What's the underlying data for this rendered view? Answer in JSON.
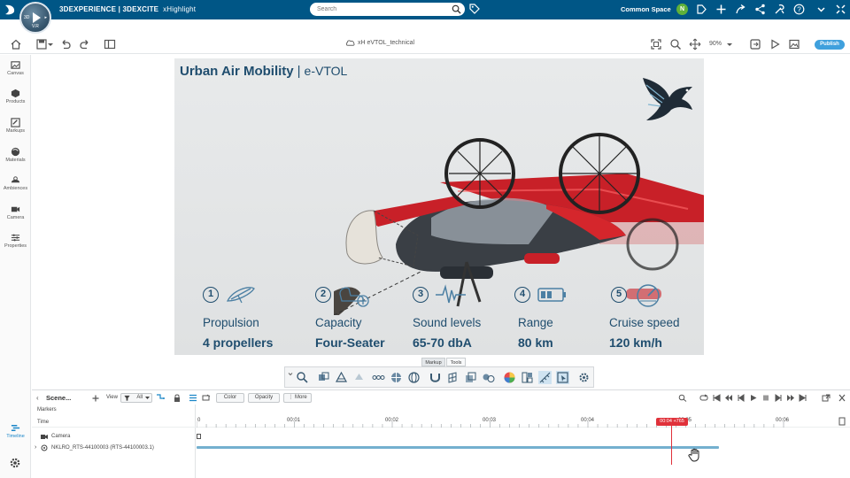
{
  "header": {
    "brand_bold": "3DEXPERIENCE | 3DEXCITE",
    "brand_app": "xHighlight",
    "compass_version": "V.R",
    "compass_left": "3D",
    "compass_right": "▸",
    "search_placeholder": "Search",
    "space_label": "Common Space",
    "avatar_initial": "N"
  },
  "toolbar": {
    "document_title": "xH eVTOL_technical",
    "zoom_level": "90%",
    "publish_label": "Publish"
  },
  "sidebar": {
    "items": [
      {
        "label": "Canvas",
        "icon": "canvas-icon"
      },
      {
        "label": "Products",
        "icon": "products-icon"
      },
      {
        "label": "Markups",
        "icon": "markups-icon"
      },
      {
        "label": "Materials",
        "icon": "materials-icon"
      },
      {
        "label": "Ambiences",
        "icon": "ambiences-icon"
      },
      {
        "label": "Camera",
        "icon": "camera-icon"
      },
      {
        "label": "Properties",
        "icon": "properties-icon"
      }
    ],
    "timeline_label": "Timeline"
  },
  "slide": {
    "title": "Urban Air Mobility",
    "separator": "|",
    "subtitle": "e-VTOL",
    "features": [
      {
        "num": "1",
        "title": "Propulsion",
        "value": "4 propellers",
        "icon": "propeller-icon"
      },
      {
        "num": "2",
        "title": "Capacity",
        "value": "Four-Seater",
        "icon": "seat-icon"
      },
      {
        "num": "3",
        "title": "Sound levels",
        "value": "65-70 dbA",
        "icon": "soundwave-icon"
      },
      {
        "num": "4",
        "title": "Range",
        "value": "80 km",
        "icon": "battery-icon"
      },
      {
        "num": "5",
        "title": "Cruise speed",
        "value": "120 km/h",
        "icon": "speedometer-icon"
      }
    ]
  },
  "markup_tabs": {
    "markup": "Markup",
    "tools": "Tools"
  },
  "timeline": {
    "scene_name": "Scene...",
    "view_label": "View",
    "view_filter": "All",
    "color_button": "Color",
    "opacity_button": "Opacity",
    "more_button": "More",
    "markers_label": "Markers",
    "time_label": "Time",
    "ruler_ticks": [
      "0",
      "00:01",
      "00:02",
      "00:03",
      "00:04",
      "00:05",
      "00:06"
    ],
    "playhead_time": "00:04 +765",
    "tracks": [
      {
        "name": "Camera",
        "icon": "camera-icon"
      },
      {
        "name": "NKLRO_RTS-44100003 (RTS-44100003.1)",
        "icon": "product-icon"
      }
    ]
  },
  "colors": {
    "header_bg": "#005686",
    "title_blue": "#1f4d6e",
    "aircraft_red": "#d5262c",
    "publish_blue": "#3fa0dd",
    "playhead_red": "#e0313a",
    "track_blue": "#74b0cf"
  }
}
